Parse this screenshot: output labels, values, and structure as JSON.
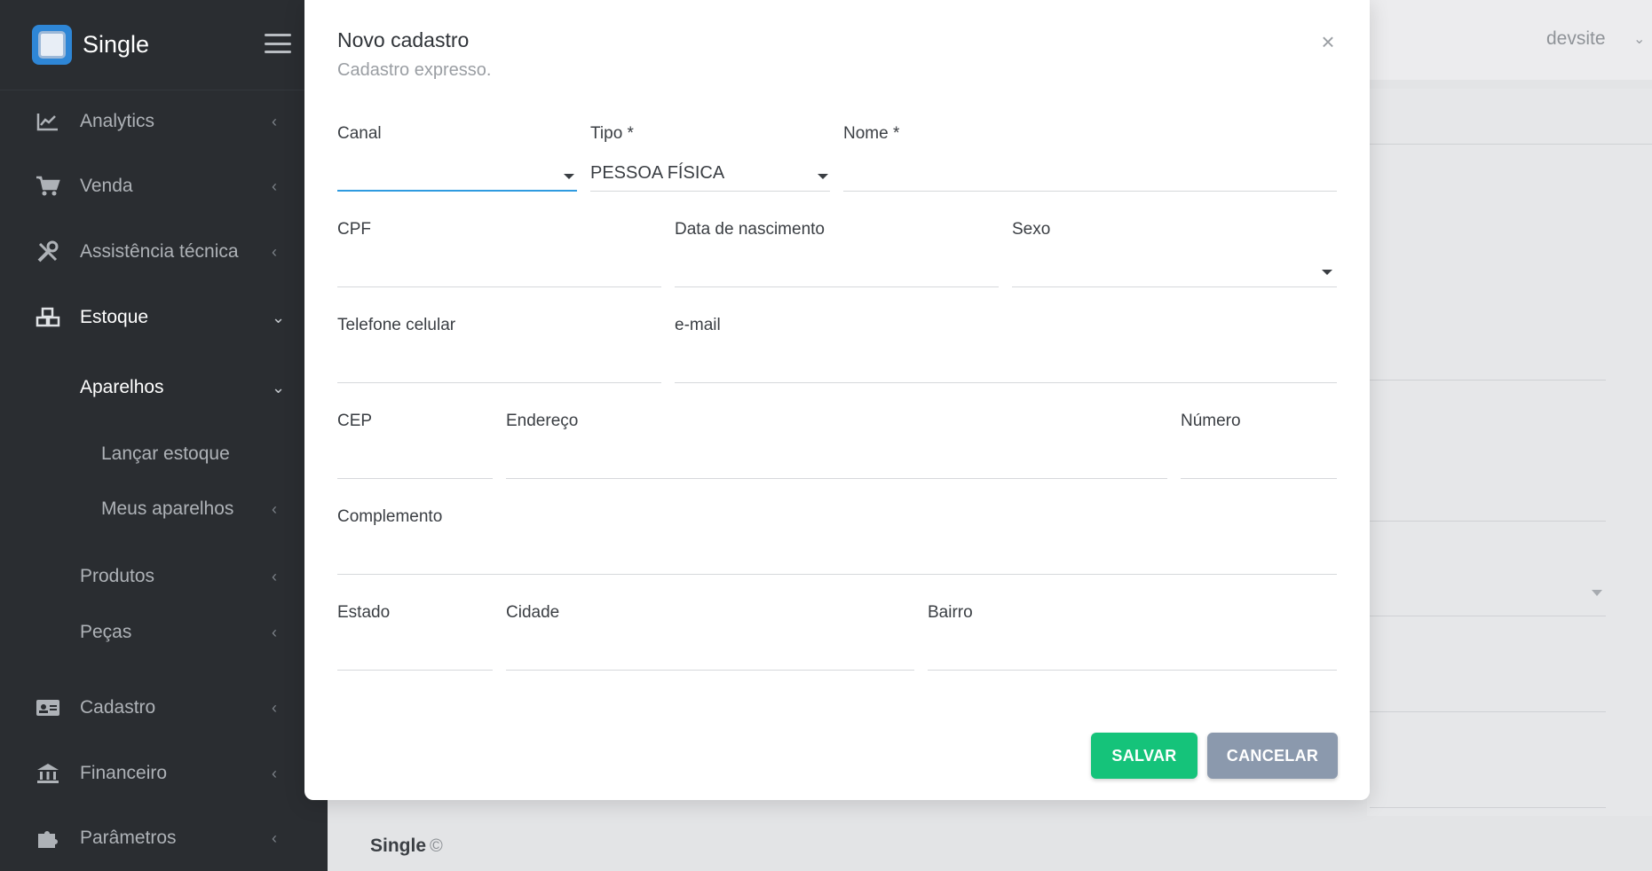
{
  "sidebar": {
    "brand": "Single",
    "items": [
      {
        "label": "Analytics",
        "icon": "chart-line-icon"
      },
      {
        "label": "Venda",
        "icon": "cart-icon"
      },
      {
        "label": "Assistência técnica",
        "icon": "tools-icon"
      },
      {
        "label": "Estoque",
        "icon": "boxes-icon"
      },
      {
        "label": "Aparelhos"
      },
      {
        "label": "Lançar estoque"
      },
      {
        "label": "Meus aparelhos"
      },
      {
        "label": "Produtos"
      },
      {
        "label": "Peças"
      },
      {
        "label": "Cadastro",
        "icon": "id-card-icon"
      },
      {
        "label": "Financeiro",
        "icon": "bank-icon"
      },
      {
        "label": "Parâmetros",
        "icon": "puzzle-icon"
      }
    ]
  },
  "header": {
    "user": "devsite"
  },
  "footer": {
    "brand": "Single",
    "copy": "©"
  },
  "modal": {
    "title": "Novo cadastro",
    "subtitle": "Cadastro expresso.",
    "fields": {
      "canal": {
        "label": "Canal",
        "value": ""
      },
      "tipo": {
        "label": "Tipo *",
        "value": "PESSOA FÍSICA"
      },
      "nome": {
        "label": "Nome *",
        "value": ""
      },
      "cpf": {
        "label": "CPF",
        "value": ""
      },
      "nascimento": {
        "label": "Data de nascimento",
        "value": ""
      },
      "sexo": {
        "label": "Sexo",
        "value": ""
      },
      "telefone": {
        "label": "Telefone celular",
        "value": ""
      },
      "email": {
        "label": "e-mail",
        "value": ""
      },
      "cep": {
        "label": "CEP",
        "value": ""
      },
      "endereco": {
        "label": "Endereço",
        "value": ""
      },
      "numero": {
        "label": "Número",
        "value": ""
      },
      "complemento": {
        "label": "Complemento",
        "value": ""
      },
      "estado": {
        "label": "Estado",
        "value": ""
      },
      "cidade": {
        "label": "Cidade",
        "value": ""
      },
      "bairro": {
        "label": "Bairro",
        "value": ""
      }
    },
    "save_label": "SALVAR",
    "cancel_label": "CANCELAR"
  },
  "colors": {
    "sidebar_bg": "#2a2d31",
    "save_button": "#15c37a",
    "cancel_button": "#8b99ad",
    "focus": "#2f9be0"
  }
}
